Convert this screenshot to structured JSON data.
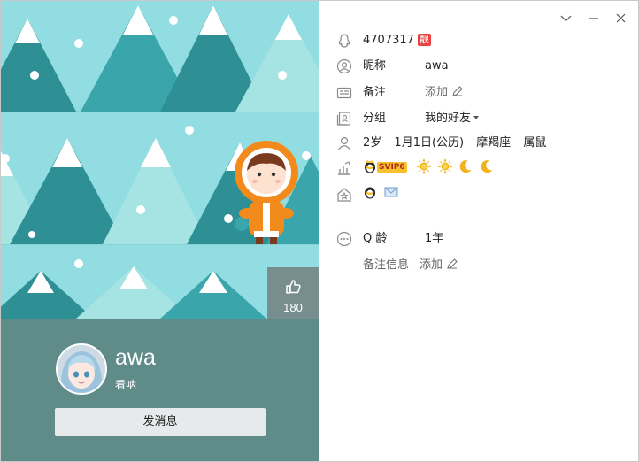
{
  "window": {
    "controls": [
      "chevron-down",
      "minimize",
      "close"
    ]
  },
  "cover": {
    "like_count": "180"
  },
  "profile": {
    "nickname": "awa",
    "signature": "看呐",
    "send_message_label": "发消息"
  },
  "info": {
    "qq_number": "4707317",
    "qq_badge": "靓",
    "nickname_label": "昵称",
    "nickname_value": "awa",
    "remark_label": "备注",
    "remark_value": "添加",
    "group_label": "分组",
    "group_value": "我的好友",
    "age": "2岁",
    "birthday": "1月1日(公历)",
    "zodiac": "摩羯座",
    "chinese_zodiac": "属鼠",
    "vip_label": "SVIP6",
    "qage_label": "Q 龄",
    "qage_value": "1年",
    "remark_info_label": "备注信息",
    "remark_info_value": "添加"
  },
  "colors": {
    "sky": "#92dde1",
    "tree_dark": "#2e8f95",
    "tree_light": "#a6e3e3",
    "panel": "#5f8c89",
    "badge_red": "#e8413f"
  }
}
